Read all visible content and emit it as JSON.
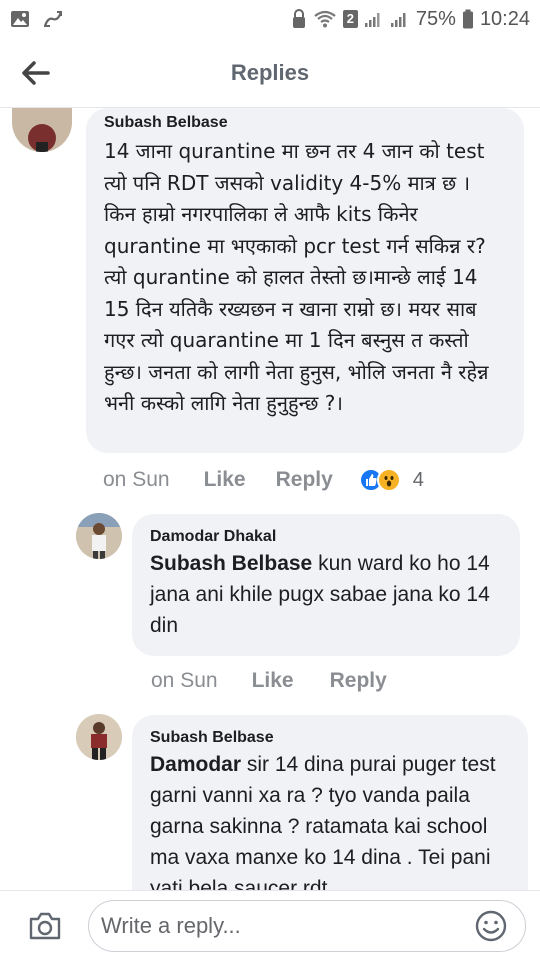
{
  "status_bar": {
    "sim_slot": "2",
    "battery": "75%",
    "time": "10:24"
  },
  "header": {
    "title": "Replies",
    "back_icon": "arrow-left-icon"
  },
  "comments": [
    {
      "author": "Subash Belbase",
      "text": "14 जाना qurantine मा छन तर 4 जान को test त्यो पनि RDT जसको validity 4-5% मात्र  छ । किन हाम्रो नगरपालिका ले आफै kits किनेर qurantine मा भएकाको pcr test गर्न सकिन्न र? त्यो qurantine को हालत तेस्तो छ।मान्छे लाई 14 15 दिन यतिकै रख्यछन न खाना राम्रो छ। मयर साब गएर त्यो quarantine मा 1 दिन बस्नुस त कस्तो हुन्छ। जनता को लागी नेता हुनुस, भोलि जनता नै रहेन्न भनी कस्को लागि नेता हुनुहुन्छ ?।",
      "time": "on Sun",
      "like_label": "Like",
      "reply_label": "Reply",
      "reaction_count": "4"
    },
    {
      "author": "Damodar Dhakal",
      "mention": "Subash Belbase",
      "text": "kun ward ko ho 14 jana ani khile pugx sabae jana ko 14 din",
      "time": "on Sun",
      "like_label": "Like",
      "reply_label": "Reply"
    },
    {
      "author": "Subash Belbase",
      "mention": "Damodar",
      "text": "sir 14 dina purai puger test garni vanni xa ra ? tyo vanda paila garna sakinna ? ratamata kai school ma vaxa manxe ko 14 dina . Tei pani yati bela saucer rdt"
    }
  ],
  "composer": {
    "placeholder": "Write a reply...",
    "camera_icon": "camera-icon",
    "emoji_icon": "smiley-icon"
  }
}
